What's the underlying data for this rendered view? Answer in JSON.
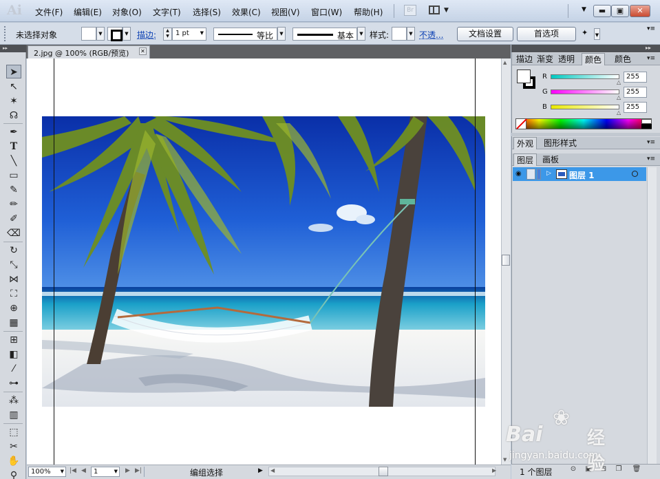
{
  "app": {
    "logo": "Ai"
  },
  "menu": {
    "items": [
      "文件(F)",
      "编辑(E)",
      "对象(O)",
      "文字(T)",
      "选择(S)",
      "效果(C)",
      "视图(V)",
      "窗口(W)",
      "帮助(H)"
    ],
    "bridge_label": "Br"
  },
  "control_bar": {
    "selection_status": "未选择对象",
    "stroke_label": "描边:",
    "stroke_weight": "1 pt",
    "profile_label": "等比",
    "brush_label": "基本",
    "style_label": "样式:",
    "opacity_label": "不透...",
    "doc_setup_button": "文档设置",
    "prefs_button": "首选项"
  },
  "document": {
    "tab_title": "2.jpg @ 100% (RGB/预览)",
    "close_glyph": "✕"
  },
  "status_bar": {
    "zoom": "100%",
    "artboard_number": "1",
    "status_text": "编组选择"
  },
  "color_panel": {
    "tabs": [
      "描边",
      "渐变",
      "透明度",
      "颜色",
      "颜色"
    ],
    "active_tab": "颜色",
    "channels": [
      {
        "label": "R",
        "value": "255",
        "color_start": "#00c8c0",
        "color_end": "#ffffff"
      },
      {
        "label": "G",
        "value": "255",
        "color_start": "#ff00ff",
        "color_end": "#ffffff"
      },
      {
        "label": "B",
        "value": "255",
        "color_start": "#e8e800",
        "color_end": "#ffffff"
      }
    ]
  },
  "appearance_panel": {
    "tabs": [
      "外观",
      "图形样式"
    ]
  },
  "layers_panel": {
    "tabs": [
      "图层",
      "画板"
    ],
    "layers": [
      {
        "name": "图层 1",
        "selected": true
      }
    ],
    "footer_count": "1 个图层"
  },
  "colors": {
    "selection_blue": "#3c98e8",
    "panel_bg": "#d5d9df",
    "close_red": "#c94b31"
  },
  "watermark": {
    "brand": "Bai",
    "brand2": "经验",
    "url": "jingyan.baidu.com"
  }
}
